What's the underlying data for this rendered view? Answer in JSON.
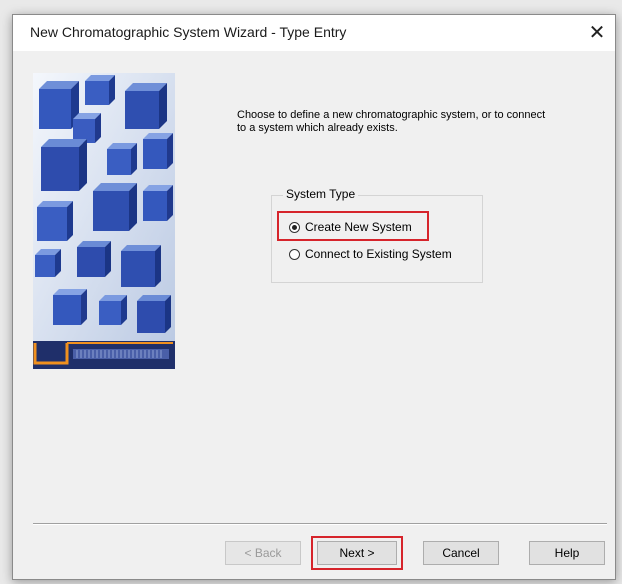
{
  "window": {
    "title": "New Chromatographic System Wizard - Type Entry",
    "close_glyph": "✕"
  },
  "instructions": "Choose to define a new chromatographic system, or to connect to a system which already exists.",
  "system_type": {
    "legend": "System Type",
    "options": [
      {
        "label": "Create New System",
        "selected": true
      },
      {
        "label": "Connect to Existing System",
        "selected": false
      }
    ]
  },
  "buttons": {
    "back": "< Back",
    "next": "Next >",
    "cancel": "Cancel",
    "help": "Help"
  },
  "colors": {
    "highlight": "#d6242b",
    "cube_blue": "#2f4fb0",
    "accent_orange": "#f0901e"
  },
  "icons": {
    "close": "close-icon",
    "side": "blue-cubes-illustration"
  }
}
